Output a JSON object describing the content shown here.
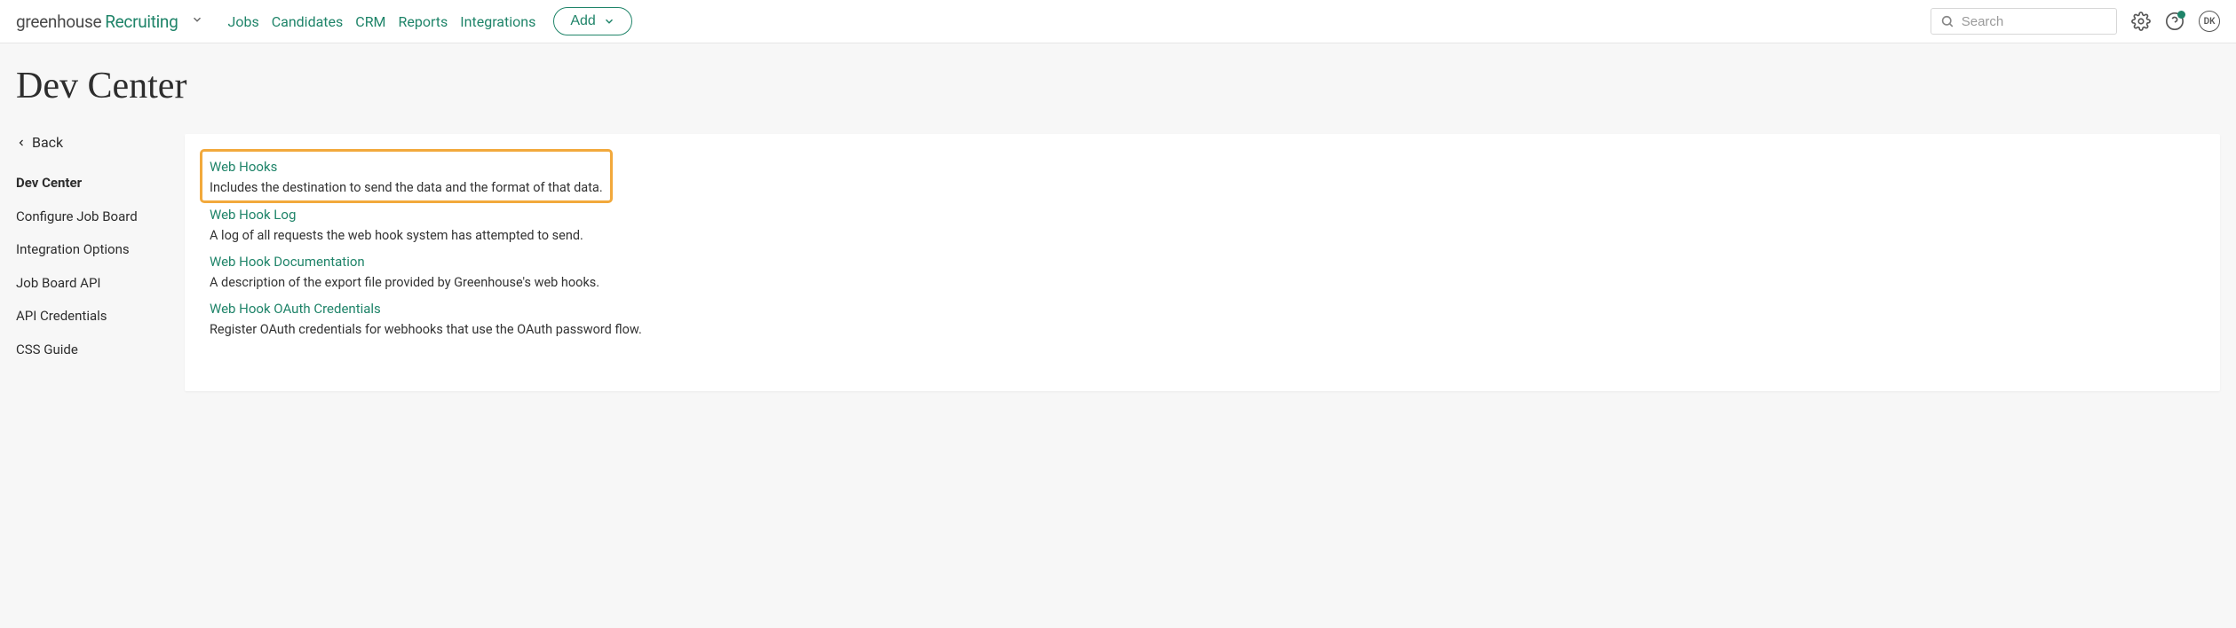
{
  "logo": {
    "brand": "greenhouse",
    "product": "Recruiting"
  },
  "nav": {
    "jobs": "Jobs",
    "candidates": "Candidates",
    "crm": "CRM",
    "reports": "Reports",
    "integrations": "Integrations"
  },
  "add_label": "Add",
  "search": {
    "placeholder": "Search"
  },
  "avatar": "DK",
  "page_title": "Dev Center",
  "back_label": "Back",
  "sidebar": {
    "items": [
      {
        "label": "Dev Center",
        "active": true
      },
      {
        "label": "Configure Job Board",
        "active": false
      },
      {
        "label": "Integration Options",
        "active": false
      },
      {
        "label": "Job Board API",
        "active": false
      },
      {
        "label": "API Credentials",
        "active": false
      },
      {
        "label": "CSS Guide",
        "active": false
      }
    ]
  },
  "main": {
    "items": [
      {
        "title": "Web Hooks",
        "desc": "Includes the destination to send the data and the format of that data.",
        "highlight": true
      },
      {
        "title": "Web Hook Log",
        "desc": "A log of all requests the web hook system has attempted to send.",
        "highlight": false
      },
      {
        "title": "Web Hook Documentation",
        "desc": "A description of the export file provided by Greenhouse's web hooks.",
        "highlight": false
      },
      {
        "title": "Web Hook OAuth Credentials",
        "desc": "Register OAuth credentials for webhooks that use the OAuth password flow.",
        "highlight": false
      }
    ]
  }
}
